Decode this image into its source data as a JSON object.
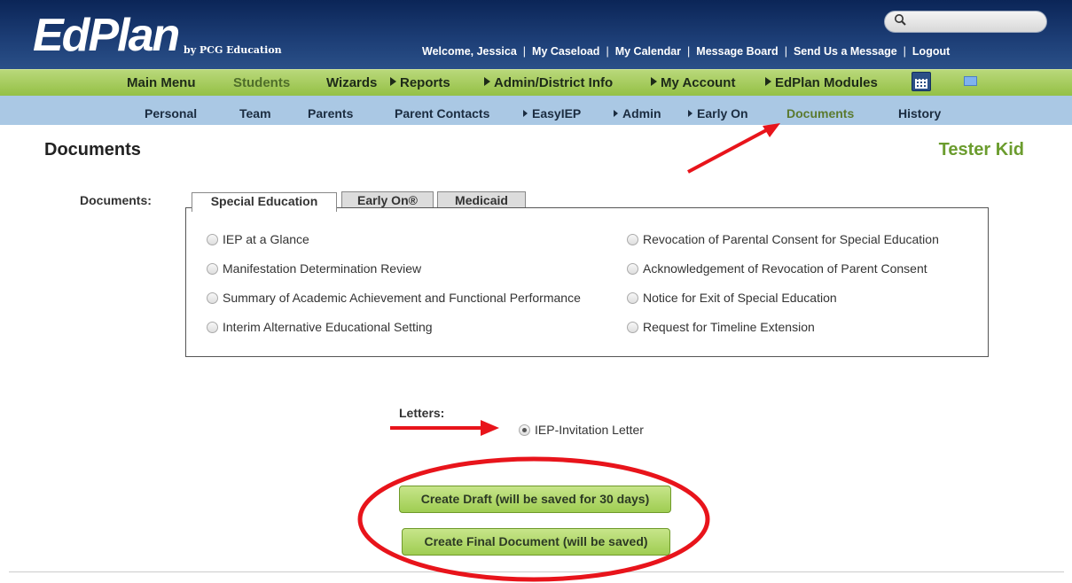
{
  "header": {
    "logo_main": "EdPlan",
    "logo_sub": "by PCG Education",
    "welcome": "Welcome, Jessica",
    "links": [
      "My Caseload",
      "My Calendar",
      "Message Board",
      "Send Us a Message",
      "Logout"
    ],
    "search_icon": "search-icon"
  },
  "main_nav": {
    "items": [
      "Main Menu",
      "Students",
      "Wizards",
      "Reports",
      "Admin/District Info",
      "My Account",
      "EdPlan Modules"
    ],
    "active": "Students",
    "calendar_icon": "calendar-icon",
    "mail_icon": "mail-icon"
  },
  "sub_nav": {
    "items": [
      "Personal",
      "Team",
      "Parents",
      "Parent Contacts",
      "EasyIEP",
      "Admin",
      "Early On",
      "Documents",
      "History"
    ],
    "active": "Documents"
  },
  "page": {
    "title": "Documents",
    "student": "Tester Kid"
  },
  "documents": {
    "label": "Documents:",
    "tabs": [
      "Special Education",
      "Early On®",
      "Medicaid"
    ],
    "active_tab": "Special Education",
    "left_options": [
      "IEP at a Glance",
      "Manifestation Determination Review",
      "Summary of Academic Achievement and Functional Performance",
      "Interim Alternative Educational Setting"
    ],
    "right_options": [
      "Revocation of Parental Consent for Special Education",
      "Acknowledgement of Revocation of Parent Consent",
      "Notice for Exit of Special Education",
      "Request for Timeline Extension"
    ]
  },
  "letters": {
    "label": "Letters:",
    "option": "IEP-Invitation Letter"
  },
  "buttons": {
    "draft": "Create Draft (will be saved for 30 days)",
    "final": "Create Final Document (will be saved)"
  },
  "colors": {
    "header_bg": "#1c3d75",
    "main_nav_bg": "#a6cc5e",
    "sub_nav_bg": "#aac8e4",
    "accent_green": "#6b9c2e",
    "annotation_red": "#e8141b"
  }
}
